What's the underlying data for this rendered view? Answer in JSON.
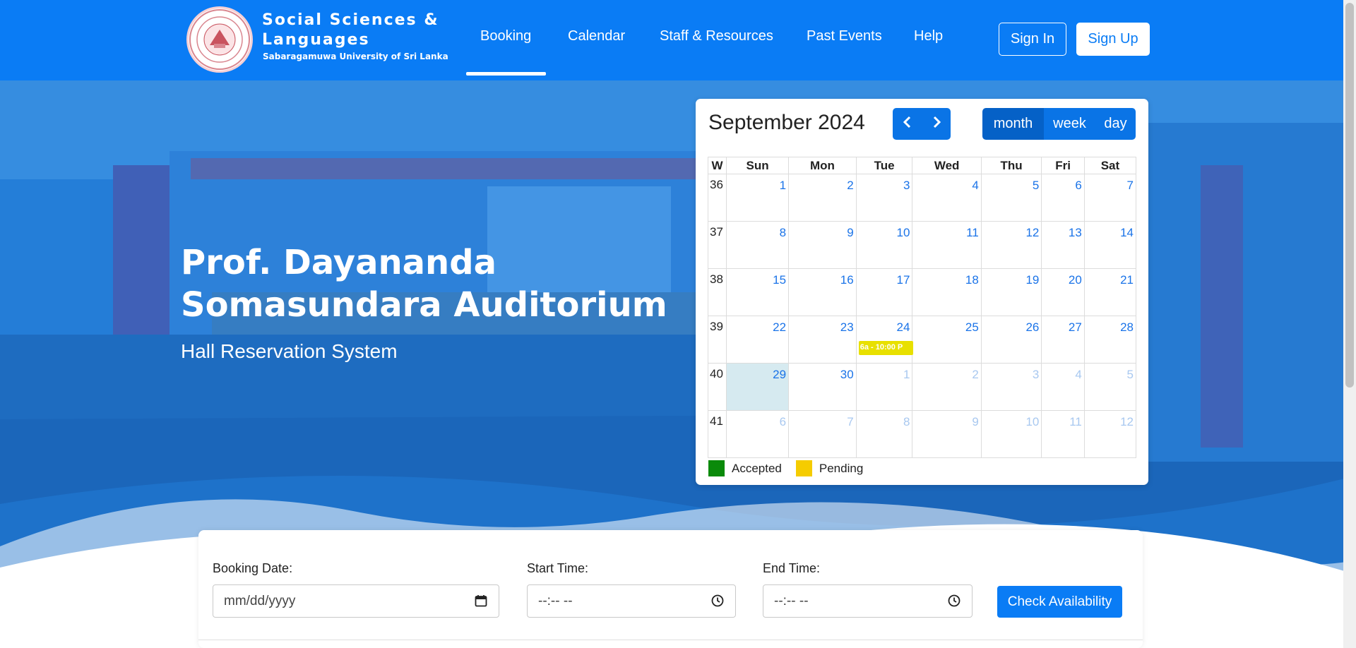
{
  "brand": {
    "title": "Social Sciences & Languages",
    "subtitle": "Sabaragamuwa University of Sri Lanka",
    "primary_color": "#0a7cf5"
  },
  "nav": {
    "items": [
      {
        "label": "Booking",
        "active": true
      },
      {
        "label": "Calendar"
      },
      {
        "label": "Staff & Resources"
      },
      {
        "label": "Past Events"
      },
      {
        "label": "Help"
      }
    ],
    "sign_in": "Sign In",
    "sign_up": "Sign Up"
  },
  "hero": {
    "title": "Prof. Dayananda Somasundara Auditorium",
    "subtitle": "Hall Reservation System"
  },
  "calendar": {
    "title": "September 2024",
    "prev_icon": "chevron-left-icon",
    "next_icon": "chevron-right-icon",
    "views": {
      "month": "month",
      "week": "week",
      "day": "day"
    },
    "active_view": "month",
    "headers": [
      "W",
      "Sun",
      "Mon",
      "Tue",
      "Wed",
      "Thu",
      "Fri",
      "Sat"
    ],
    "weeks": [
      {
        "wk": "36",
        "days": [
          "1",
          "2",
          "3",
          "4",
          "5",
          "6",
          "7"
        ]
      },
      {
        "wk": "37",
        "days": [
          "8",
          "9",
          "10",
          "11",
          "12",
          "13",
          "14"
        ]
      },
      {
        "wk": "38",
        "days": [
          "15",
          "16",
          "17",
          "18",
          "19",
          "20",
          "21"
        ]
      },
      {
        "wk": "39",
        "days": [
          "22",
          "23",
          "24",
          "25",
          "26",
          "27",
          "28"
        ]
      },
      {
        "wk": "40",
        "days": [
          "29",
          "30",
          "1",
          "2",
          "3",
          "4",
          "5"
        ]
      },
      {
        "wk": "41",
        "days": [
          "6",
          "7",
          "8",
          "9",
          "10",
          "11",
          "12"
        ]
      }
    ],
    "today": "29",
    "event": {
      "text": "6a - 10:00 P",
      "day": "24",
      "status": "Pending"
    },
    "legend": [
      {
        "label": "Accepted",
        "color": "#0a8a0a"
      },
      {
        "label": "Pending",
        "color": "#f5cc00"
      }
    ]
  },
  "booking_form": {
    "date_label": "Booking Date:",
    "date_placeholder": "mm/dd/yyyy",
    "start_label": "Start Time:",
    "start_placeholder": "--:-- --",
    "end_label": "End Time:",
    "end_placeholder": "--:-- --",
    "check_button": "Check Availability"
  }
}
